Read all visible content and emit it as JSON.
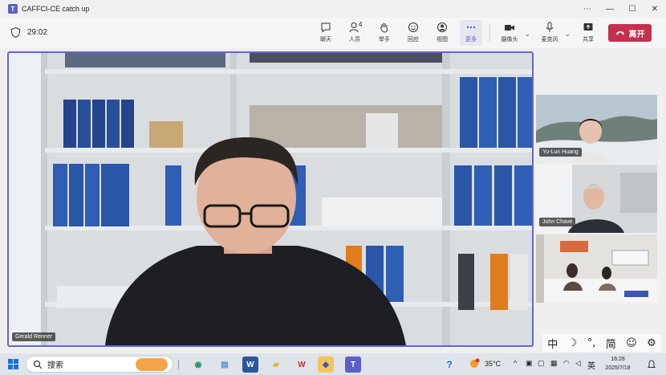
{
  "window": {
    "title": "CAFFCI-CE catch up",
    "controls": [
      "more-icon",
      "minimize-icon",
      "maximize-icon",
      "close-icon"
    ]
  },
  "meeting": {
    "elapsed": "29:02",
    "toolbar": {
      "chat": "聊天",
      "people": "人员",
      "people_count": "4",
      "raise_hand": "举手",
      "react": "回应",
      "view": "视图",
      "more": "更多",
      "camera": "摄像头",
      "mic": "麦克风",
      "share": "共享",
      "leave": "离开"
    },
    "leave_color": "#c4314b",
    "accent_color": "#5b5fc7"
  },
  "participants": {
    "main": {
      "name": "Gerald Renner"
    },
    "thumbnails": [
      {
        "name": "Yu-Lun Huang"
      },
      {
        "name": "John Chave"
      },
      {
        "name": ""
      }
    ]
  },
  "ime_bar": {
    "items": [
      "中",
      "☽",
      "°,",
      "简",
      "☺",
      "⚙"
    ]
  },
  "taskbar": {
    "search_placeholder": "搜索",
    "weather": "35°C",
    "lang": "英",
    "time": "16:28",
    "date": "2025/7/18"
  }
}
